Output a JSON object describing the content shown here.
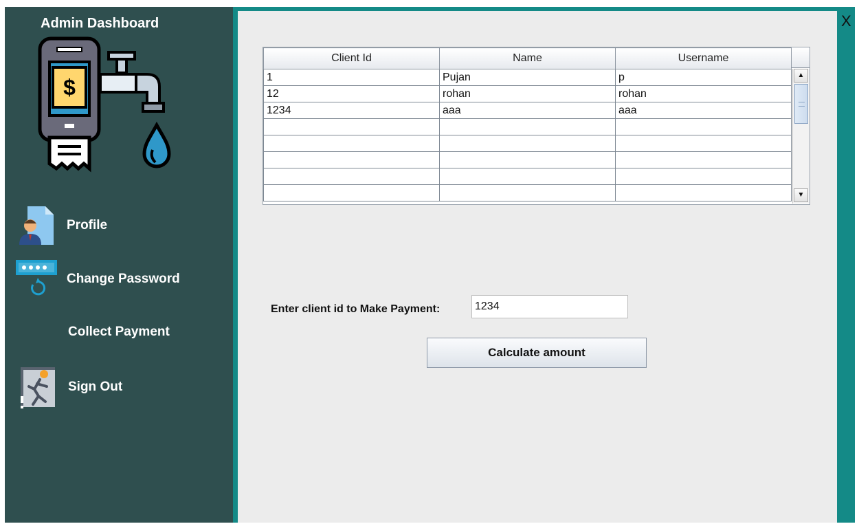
{
  "window": {
    "close_label": "X"
  },
  "sidebar": {
    "title": "Admin Dashboard",
    "logo_icon": "water-bill-payment-icon",
    "items": [
      {
        "label": "Profile",
        "icon": "user-profile-icon"
      },
      {
        "label": "Change Password",
        "icon": "password-reset-icon"
      },
      {
        "label": "Collect Payment",
        "icon": ""
      },
      {
        "label": "Sign Out",
        "icon": "sign-out-icon"
      }
    ]
  },
  "table": {
    "headers": [
      "Client Id",
      "Name",
      "Username"
    ],
    "rows": [
      [
        "1",
        "Pujan",
        "p"
      ],
      [
        "12",
        "rohan",
        "rohan"
      ],
      [
        "1234",
        "aaa",
        "aaa"
      ],
      [
        "",
        "",
        ""
      ],
      [
        "",
        "",
        ""
      ],
      [
        "",
        "",
        ""
      ],
      [
        "",
        "",
        ""
      ],
      [
        "",
        "",
        ""
      ]
    ]
  },
  "payment": {
    "label": "Enter client id to Make Payment:",
    "client_id_value": "1234",
    "button_label": "Calculate amount"
  },
  "colors": {
    "sidebar_bg": "#2f4f4f",
    "frame_teal": "#148a87",
    "panel_bg": "#ececec"
  }
}
